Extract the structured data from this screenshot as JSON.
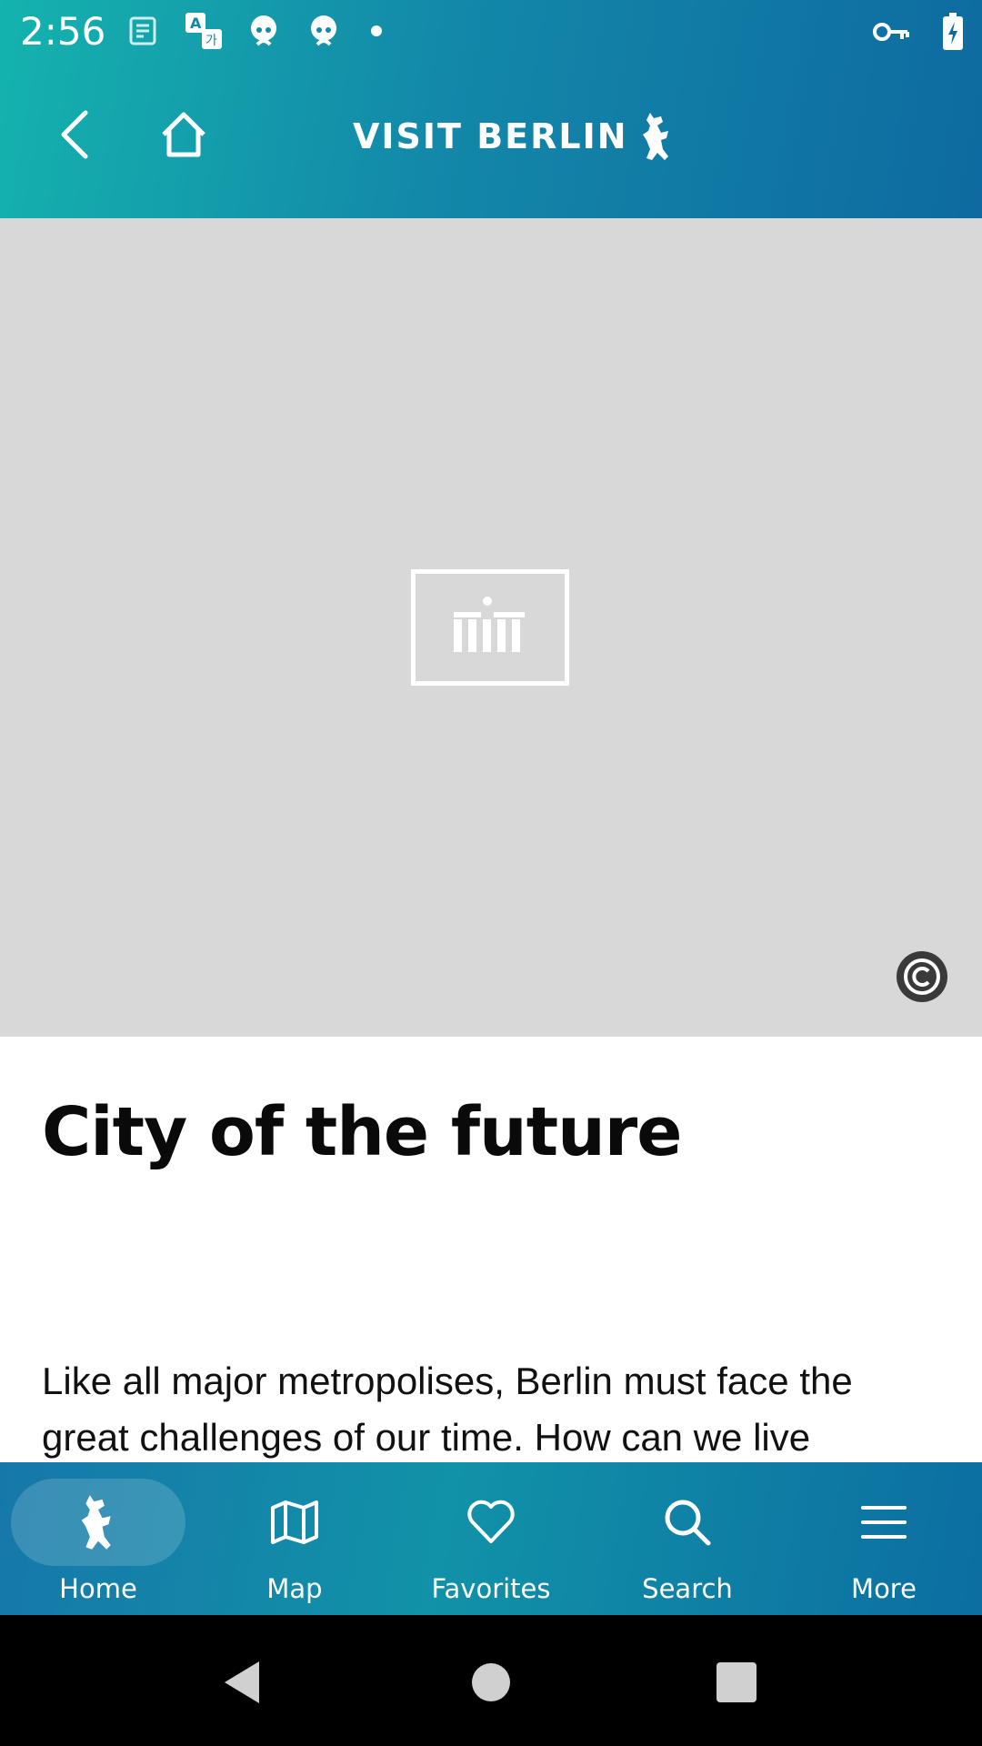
{
  "status_bar": {
    "time": "2:56",
    "icons": [
      "notes-icon",
      "translate-icon",
      "face-icon",
      "face-icon",
      "dot-icon"
    ],
    "right_icons": [
      "vpn-key-icon",
      "battery-charging-icon"
    ]
  },
  "header": {
    "brand": "VISIT BERLIN",
    "icons": [
      "back-arrow-icon",
      "home-icon",
      "berlin-bear-icon"
    ]
  },
  "hero": {
    "placeholder_icon": "image-placeholder-icon",
    "copyright_icon": "copyright-icon"
  },
  "article": {
    "title": "City of the future",
    "intro": "Like all major metropolises, Berlin must face the great challenges of our time. How can we live"
  },
  "bottom_nav": {
    "items": [
      {
        "label": "Home",
        "icon": "bear-icon",
        "active": true
      },
      {
        "label": "Map",
        "icon": "map-icon",
        "active": false
      },
      {
        "label": "Favorites",
        "icon": "heart-icon",
        "active": false
      },
      {
        "label": "Search",
        "icon": "search-icon",
        "active": false
      },
      {
        "label": "More",
        "icon": "menu-icon",
        "active": false
      }
    ]
  },
  "colors": {
    "header_gradient_start": "#14b3ae",
    "header_gradient_end": "#0e6aa0",
    "hero_background": "#d8d8d9",
    "nav_background": "#1388a9"
  }
}
